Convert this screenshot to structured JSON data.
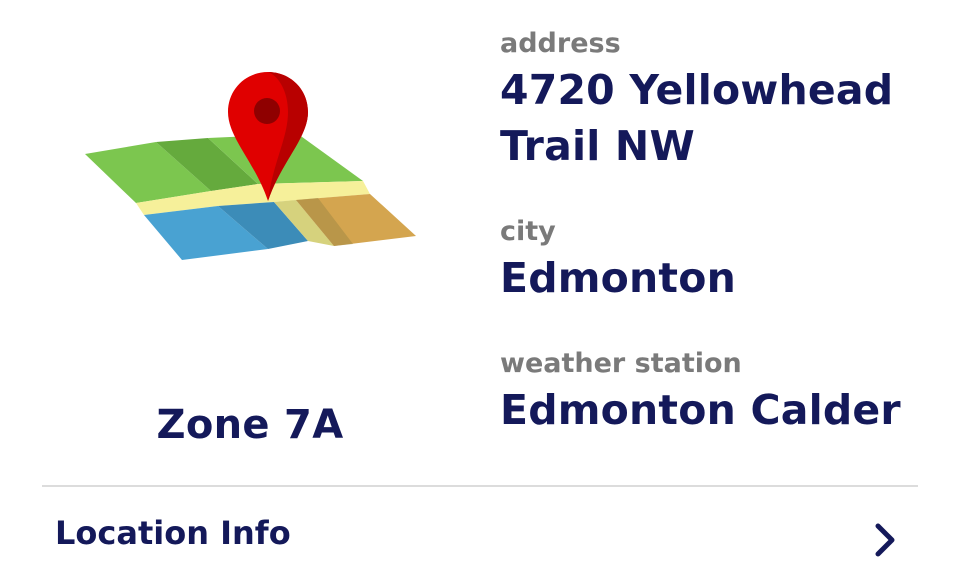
{
  "zone": {
    "label": "Zone 7A"
  },
  "address": {
    "label": "address",
    "value": "4720 Yellowhead Trail NW"
  },
  "city": {
    "label": "city",
    "value": "Edmonton"
  },
  "weather_station": {
    "label": "weather station",
    "value": "Edmonton Calder"
  },
  "location_info": {
    "label": "Location Info",
    "icon": "chevron-right-icon"
  },
  "colors": {
    "text_primary": "#14195a",
    "text_secondary": "#7a7a7a",
    "divider": "#dcdcdc",
    "pin_red": "#e00000"
  },
  "icons": {
    "map": "map-pin-icon"
  }
}
